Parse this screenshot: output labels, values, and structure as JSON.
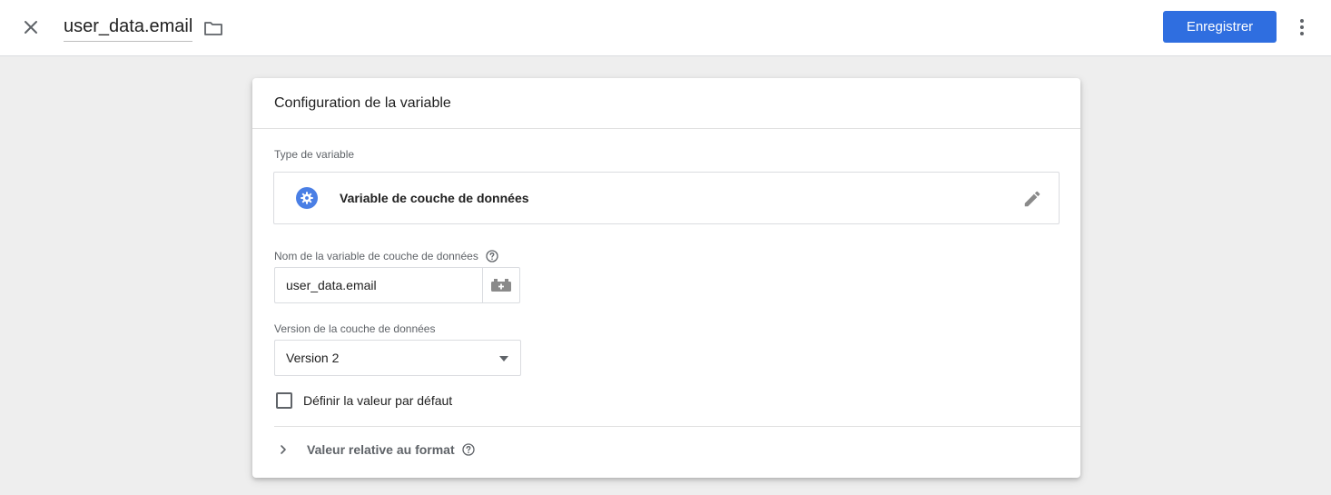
{
  "topbar": {
    "title": "user_data.email",
    "save_label": "Enregistrer"
  },
  "card": {
    "header_title": "Configuration de la variable",
    "type_label": "Type de variable",
    "type_name": "Variable de couche de données",
    "name_label": "Nom de la variable de couche de données",
    "name_value": "user_data.email",
    "version_label": "Version de la couche de données",
    "version_selected": "Version 2",
    "default_value_label": "Définir la valeur par défaut",
    "default_value_checked": false,
    "format_section_label": "Valeur relative au format"
  },
  "colors": {
    "accent": "#2f6ee0",
    "type_icon": "#4a7fe5",
    "icon_gray": "#5f6368"
  },
  "icons": {
    "close": "close-icon",
    "folder": "folder-icon",
    "more": "more-vert-icon",
    "type": "settings-gear-icon",
    "edit": "pencil-icon",
    "help": "help-circle-icon",
    "variable_picker": "add-variable-icon",
    "dropdown": "caret-down-icon",
    "expand": "chevron-right-icon"
  }
}
